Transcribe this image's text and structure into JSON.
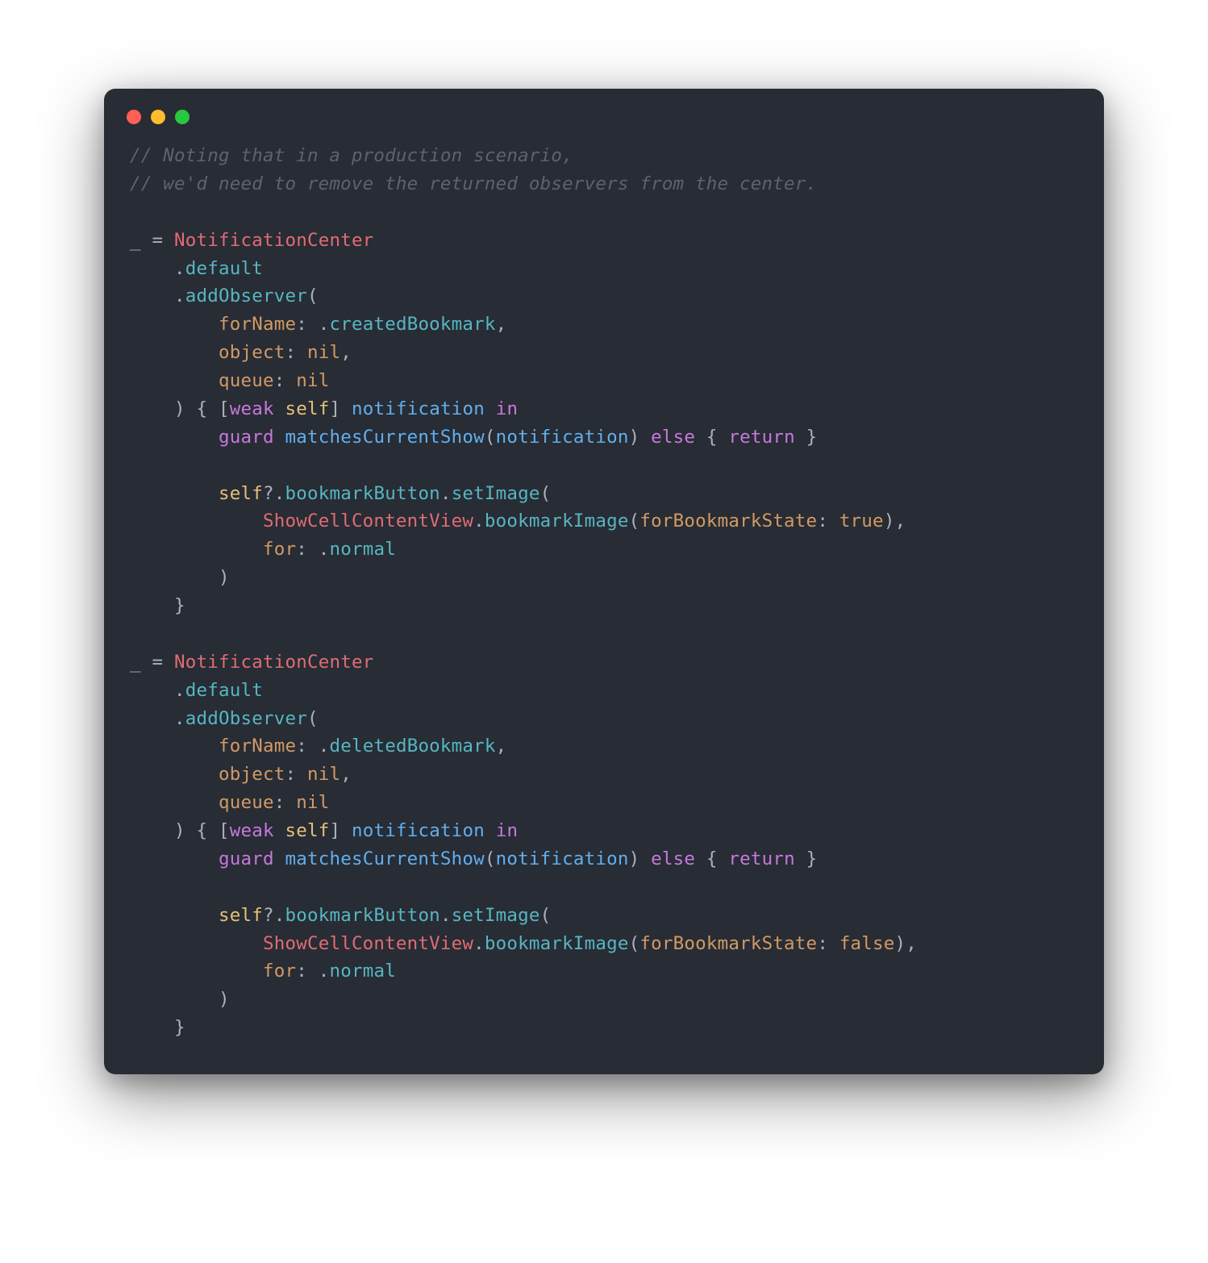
{
  "window": {
    "buttons": [
      "close",
      "minimize",
      "zoom"
    ]
  },
  "code": {
    "comments": [
      "// Noting that in a production scenario,",
      "// we'd need to remove the returned observers from the center."
    ],
    "underscore": "_",
    "eq": " = ",
    "NotificationCenter": "NotificationCenter",
    "dot": ".",
    "default": "default",
    "addObserver": "addObserver",
    "openParen": "(",
    "closeParen": ")",
    "forName": "forName",
    "colon": ":",
    "createdBookmark": "createdBookmark",
    "deletedBookmark": "deletedBookmark",
    "comma": ",",
    "object": "object",
    "nil": "nil",
    "queue": "queue",
    "openBrace": "{",
    "closeBrace": "}",
    "openBracket": "[",
    "closeBracket": "]",
    "weak": "weak",
    "self": "self",
    "notification": "notification",
    "in": "in",
    "guard": "guard",
    "matchesCurrentShow": "matchesCurrentShow",
    "else": "else",
    "return": "return",
    "qmark": "?",
    "bookmarkButton": "bookmarkButton",
    "setImage": "setImage",
    "ShowCellContentView": "ShowCellContentView",
    "bookmarkImage": "bookmarkImage",
    "forBookmarkState": "forBookmarkState",
    "true": "true",
    "false": "false",
    "for": "for",
    "normal": "normal",
    "space": " "
  }
}
